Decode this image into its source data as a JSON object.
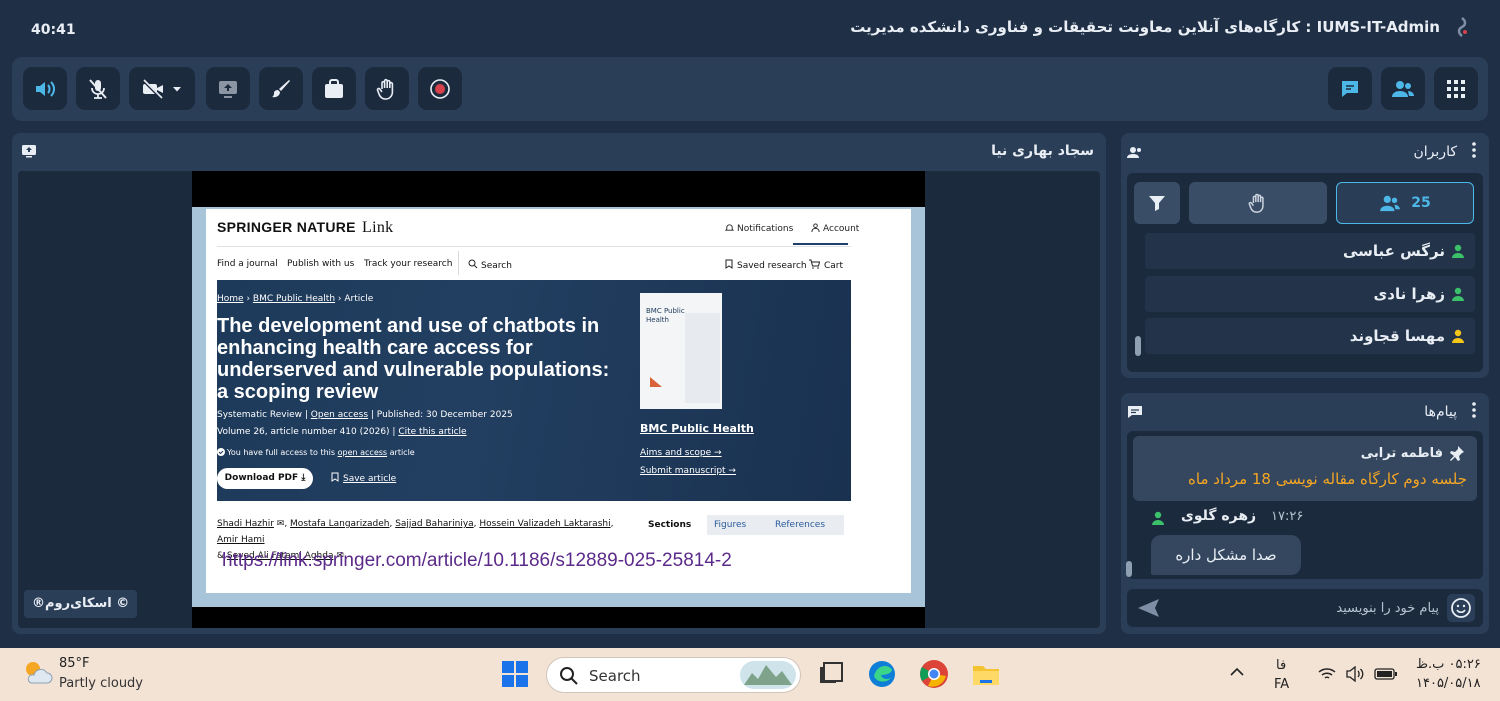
{
  "header": {
    "timer": "40:41",
    "room_title": "IUMS-IT-Admin : کارگاه‌های آنلاین معاونت تحقیقات و فناوری دانشکده مدیریت"
  },
  "toolbar": {
    "left_buttons": [
      "speaker-icon",
      "mic-muted-icon",
      "camera-off-icon",
      "share-screen-icon",
      "whiteboard-icon",
      "files-icon",
      "raise-hand-icon",
      "record-icon"
    ],
    "right_buttons": [
      "chat-icon",
      "users-icon",
      "apps-grid-icon"
    ],
    "accent_color": "#4db8e8"
  },
  "video": {
    "presenter_name": "سجاد بهاری نیا",
    "watermark": "®اسکای‌روم ©"
  },
  "shared_page": {
    "brand": "SPRINGER NATURE",
    "brand_link": "Link",
    "notifications": "Notifications",
    "account": "Account",
    "nav": [
      "Find a journal",
      "Publish with us",
      "Track your research",
      "Search"
    ],
    "saved_research": "Saved research",
    "cart": "Cart",
    "breadcrumb": [
      "Home",
      "BMC Public Health",
      "Article"
    ],
    "title": "The development and use of chatbots in enhancing health care access for underserved and vulnerable populations: a scoping review",
    "meta_type": "Systematic Review",
    "meta_access": "Open access",
    "meta_published": "Published: 30 December 2025",
    "meta_volume": "Volume 26, article number 410 (2026)",
    "meta_cite": "Cite this article",
    "access_note_pre": "You have full access to this",
    "access_note_link": "open access",
    "access_note_post": "article",
    "download_pdf": "Download PDF",
    "save_article": "Save article",
    "journal_cover_label": "BMC Public Health",
    "journal_name": "BMC Public Health",
    "aims_scope": "Aims and scope",
    "submit_manuscript": "Submit manuscript",
    "authors": [
      "Shadi Hazhir",
      "Mostafa Langarizadeh",
      "Sajjad Bahariniya",
      "Hossein Valizadeh Laktarashi",
      "Amir Hami",
      "Seyed Ali Fatemi Aghda"
    ],
    "tabs": [
      "Sections",
      "Figures",
      "References"
    ],
    "url": "https://link.springer.com/article/10.1186/s12889-025-25814-2"
  },
  "users_panel": {
    "title": "کاربران",
    "count": "25",
    "users": [
      {
        "name": "نرگس عباسی",
        "status_color": "#3cc16b"
      },
      {
        "name": "زهرا نادی",
        "status_color": "#3cc16b"
      },
      {
        "name": "مهسا قجاوند",
        "status_color": "#f5c518"
      }
    ]
  },
  "messages_panel": {
    "title": "پیام‌ها",
    "pinned_author": "فاطمه ترابی",
    "pinned_text": "جلسه دوم کارگاه مقاله نویسی 18 مرداد ماه",
    "message_author": "زهره گلوی",
    "message_time": "۱۷:۲۶",
    "message_text": "صدا مشکل داره",
    "compose_placeholder": "پیام خود را بنویسید"
  },
  "taskbar": {
    "temperature": "85°F",
    "weather": "Partly cloudy",
    "search": "Search",
    "lang_short": "فا",
    "lang": "FA",
    "time": "۰۵:۲۶ ب.ظ",
    "date": "۱۴۰۵/۰۵/۱۸"
  }
}
